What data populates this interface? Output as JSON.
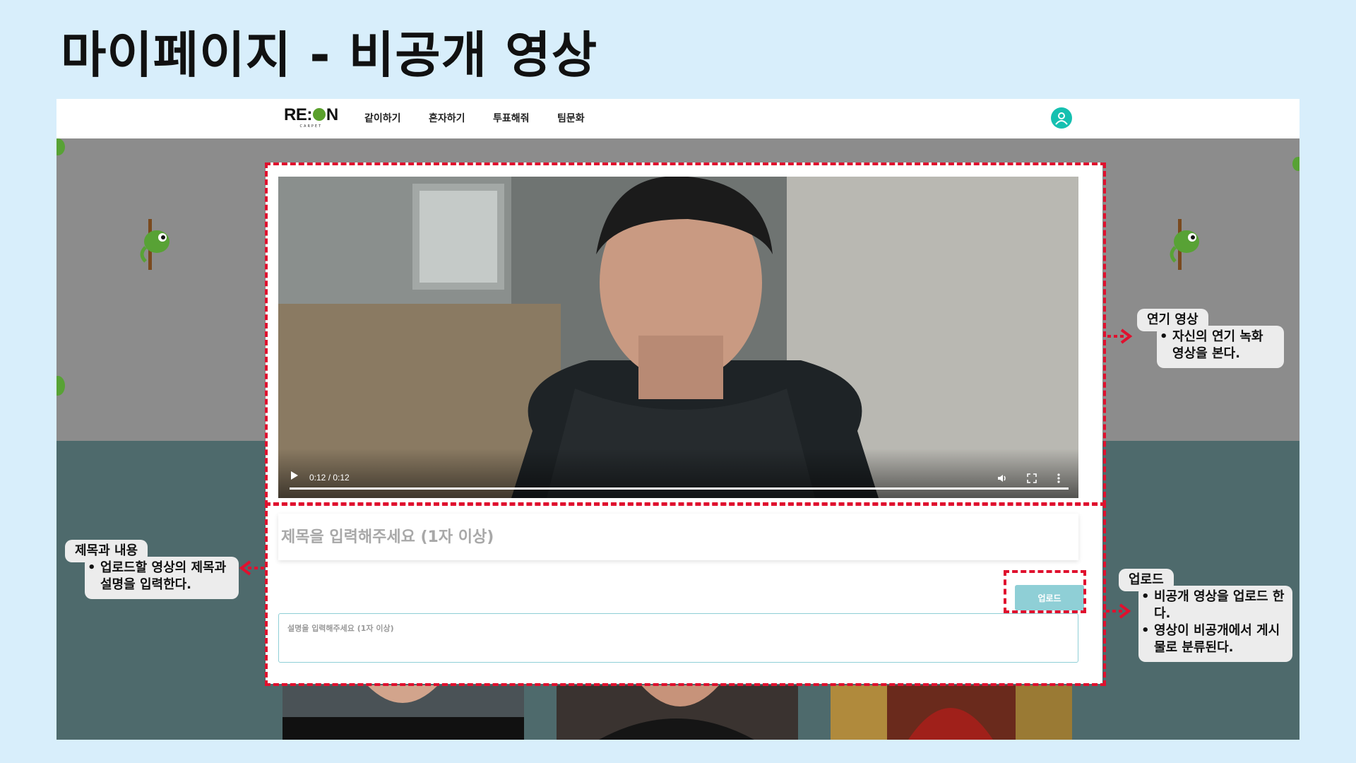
{
  "slide": {
    "title": "마이페이지 - 비공개 영상"
  },
  "navbar": {
    "logo": {
      "text_prefix": "RE:",
      "text_suffix": "N",
      "subtitle": "CARPET"
    },
    "items": [
      {
        "label": "같이하기"
      },
      {
        "label": "혼자하기"
      },
      {
        "label": "투표해줘"
      },
      {
        "label": "팀문화"
      }
    ],
    "avatar_icon": "user-avatar-icon"
  },
  "video": {
    "time": "0:12 / 0:12",
    "progress": 1.0,
    "controls": [
      "play-icon",
      "volume-icon",
      "fullscreen-icon",
      "more-options-icon"
    ]
  },
  "form": {
    "title_placeholder": "제목을 입력해주세요 (1자 이상)",
    "upload_label": "업로드",
    "description_placeholder": "설명을 입력해주세요 (1자 이상)"
  },
  "annotations": {
    "video": {
      "heading": "연기 영상",
      "bullets": [
        "자신의 연기 녹화 영상을 본다."
      ]
    },
    "title_desc": {
      "heading": "제목과 내용",
      "bullets": [
        "업로드할 영상의 제목과 설명을 입력한다."
      ]
    },
    "upload": {
      "heading": "업로드",
      "bullets": [
        "비공개 영상을 업로드 한다.",
        "영상이 비공개에서 게시물로 분류된다."
      ]
    }
  },
  "colors": {
    "page_background": "#d8eefb",
    "annotation_red": "#e0102e",
    "upload_button": "#8fcfd6",
    "avatar": "#16c0b0",
    "wall_bottom": "#4e6a6c",
    "wall_top": "#8c8c8c"
  }
}
